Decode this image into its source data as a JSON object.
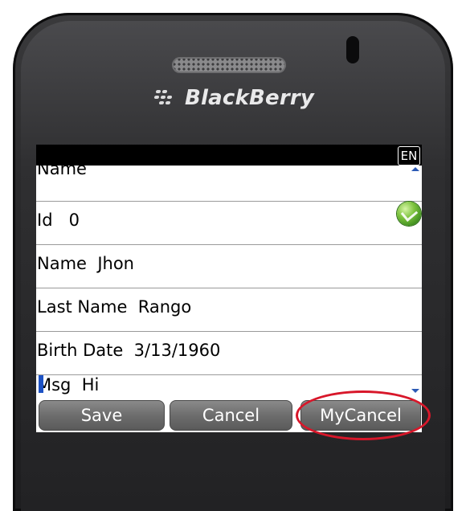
{
  "device": {
    "brand": "BlackBerry"
  },
  "status_bar": {
    "lang_indicator": "EN"
  },
  "form": {
    "header_label": "Name",
    "fields": [
      {
        "label": "Id",
        "value": "0"
      },
      {
        "label": "Name",
        "value": "Jhon"
      },
      {
        "label": "Last Name",
        "value": "Rango"
      },
      {
        "label": "Birth Date",
        "value": "3/13/1960"
      },
      {
        "label": "Msg",
        "value": "Hi"
      }
    ]
  },
  "buttons": {
    "save": "Save",
    "cancel": "Cancel",
    "mycancel": "MyCancel"
  },
  "colors": {
    "highlight_ring": "#d8172a",
    "cursor": "#1d52c4",
    "scroll_arrows": "#2b59b5"
  }
}
